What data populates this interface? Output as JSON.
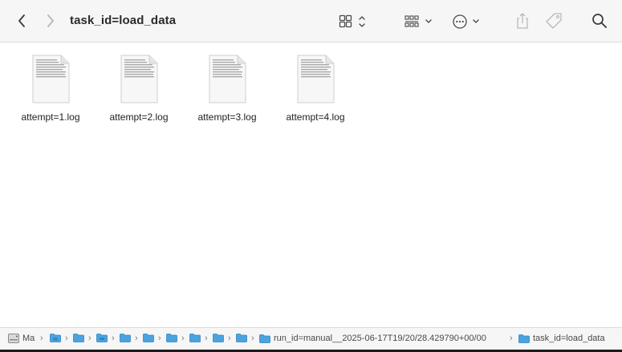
{
  "window": {
    "title": "task_id=load_data"
  },
  "toolbar": {
    "back_icon": "chevron-left-icon",
    "forward_icon": "chevron-right-icon",
    "view_icon": "grid-view-icon",
    "group_icon": "group-icon",
    "action_icon": "ellipsis-circle-icon",
    "share_icon": "share-icon",
    "tag_icon": "tag-icon",
    "search_icon": "search-icon"
  },
  "files": [
    {
      "name": "attempt=1.log"
    },
    {
      "name": "attempt=2.log"
    },
    {
      "name": "attempt=3.log"
    },
    {
      "name": "attempt=4.log"
    }
  ],
  "pathbar": {
    "disk_label": "Ma",
    "run_label": "run_id=manual__2025-06-17T19/20/28.429790+00/00",
    "task_label": "task_id=load_data",
    "separator": "›"
  },
  "colors": {
    "folder_blue": "#4aa3df",
    "toolbar_bg": "#f6f6f6"
  }
}
